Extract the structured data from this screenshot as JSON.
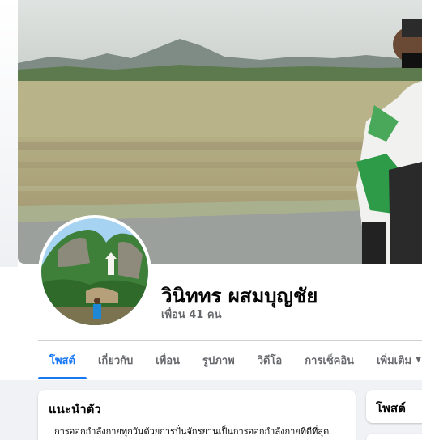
{
  "profile": {
    "name": "วินิททร ผสมบุญชัย",
    "friends": "เพื่อน 41 คน"
  },
  "tabs": [
    {
      "label": "โพสต์",
      "active": true
    },
    {
      "label": "เกี่ยวกับ"
    },
    {
      "label": "เพื่อน"
    },
    {
      "label": "รูปภาพ"
    },
    {
      "label": "วิดีโอ"
    },
    {
      "label": "การเช็คอิน"
    },
    {
      "label": "เพิ่มเติม",
      "caret": "▼"
    }
  ],
  "intro": {
    "title": "แนะนำตัว",
    "text": "การออกกำลังกายทุกวันด้วยการปั่นจักรยานเป็นการออกกำลังกายที่ดีที่สุด"
  },
  "side": {
    "title": "โพสต์"
  },
  "colors": {
    "accent": "#1877f2",
    "secondary_text": "#65676b",
    "background": "#f0f2f5"
  }
}
